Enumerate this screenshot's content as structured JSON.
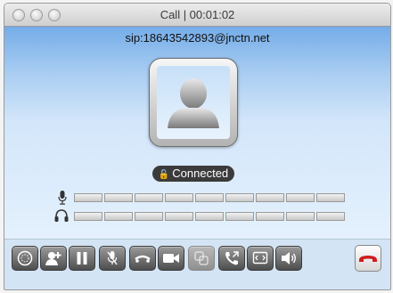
{
  "window": {
    "title": "Call | 00:01:02"
  },
  "call": {
    "remote_uri": "sip:18643542893@jnctn.net",
    "status": "Connected"
  },
  "meters": {
    "microphone_segments": 9,
    "headset_segments": 9
  },
  "toolbar": {
    "buttons": [
      {
        "name": "dialpad-button",
        "icon": "dialpad-icon",
        "enabled": true
      },
      {
        "name": "add-participant-button",
        "icon": "add-contact-icon",
        "enabled": true
      },
      {
        "name": "hold-button",
        "icon": "pause-icon",
        "enabled": true
      },
      {
        "name": "mute-button",
        "icon": "mic-mute-icon",
        "enabled": true
      },
      {
        "name": "transfer-button",
        "icon": "transfer-icon",
        "enabled": true
      },
      {
        "name": "video-button",
        "icon": "video-camera-icon",
        "enabled": true
      },
      {
        "name": "merge-button",
        "icon": "merge-icon",
        "enabled": false
      },
      {
        "name": "call-transfer-button",
        "icon": "phone-transfer-icon",
        "enabled": true
      },
      {
        "name": "desktop-share-button",
        "icon": "screen-share-icon",
        "enabled": true
      },
      {
        "name": "volume-button",
        "icon": "speaker-icon",
        "enabled": true
      }
    ],
    "hangup": {
      "name": "hangup-button",
      "icon": "hangup-icon",
      "color": "#d01c1c"
    }
  }
}
